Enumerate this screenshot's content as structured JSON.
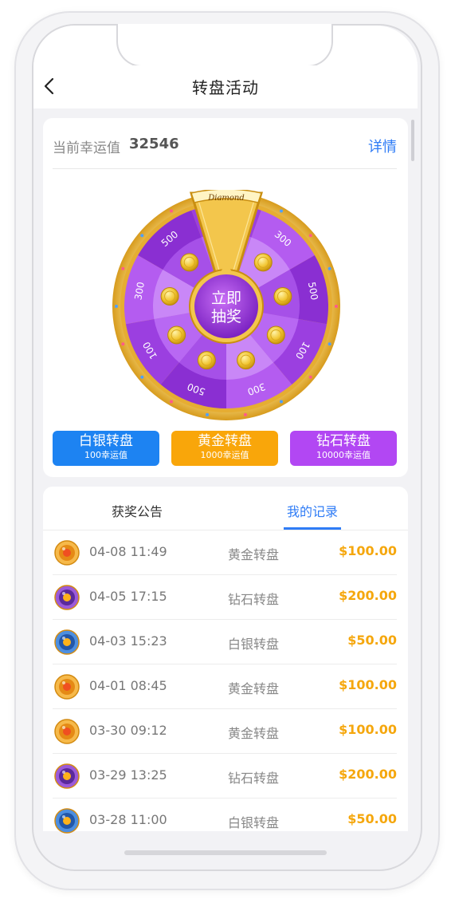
{
  "header": {
    "title": "转盘活动"
  },
  "luck": {
    "label": "当前幸运值",
    "value": "32546",
    "detail_link": "详情"
  },
  "wheel": {
    "brand": "Diamond",
    "spin_label_line1": "立即",
    "spin_label_line2": "抽奖",
    "segments": [
      "100",
      "300",
      "500",
      "100",
      "300",
      "500",
      "100",
      "300",
      "500"
    ]
  },
  "wheel_buttons": [
    {
      "label": "白银转盘",
      "sub": "100幸运值"
    },
    {
      "label": "黄金转盘",
      "sub": "1000幸运值"
    },
    {
      "label": "钻石转盘",
      "sub": "10000幸运值"
    }
  ],
  "tabs": {
    "announce": "获奖公告",
    "records": "我的记录"
  },
  "records": [
    {
      "time": "04-08 11:49",
      "type": "黄金转盘",
      "amount": "$100.00",
      "medal": "gold-medal-icon"
    },
    {
      "time": "04-05 17:15",
      "type": "钻石转盘",
      "amount": "$200.00",
      "medal": "diamond-medal-icon"
    },
    {
      "time": "04-03 15:23",
      "type": "白银转盘",
      "amount": "$50.00",
      "medal": "silver-medal-icon"
    },
    {
      "time": "04-01 08:45",
      "type": "黄金转盘",
      "amount": "$100.00",
      "medal": "gold-medal-icon"
    },
    {
      "time": "03-30 09:12",
      "type": "黄金转盘",
      "amount": "$100.00",
      "medal": "gold-medal-icon"
    },
    {
      "time": "03-29 13:25",
      "type": "钻石转盘",
      "amount": "$200.00",
      "medal": "diamond-medal-icon"
    },
    {
      "time": "03-28 11:00",
      "type": "白银转盘",
      "amount": "$50.00",
      "medal": "silver-medal-icon"
    }
  ],
  "colors": {
    "accent_blue": "#2f7cf6",
    "gold": "#f9a60a",
    "diamond": "#b247f3",
    "amount": "#f5a70d"
  }
}
